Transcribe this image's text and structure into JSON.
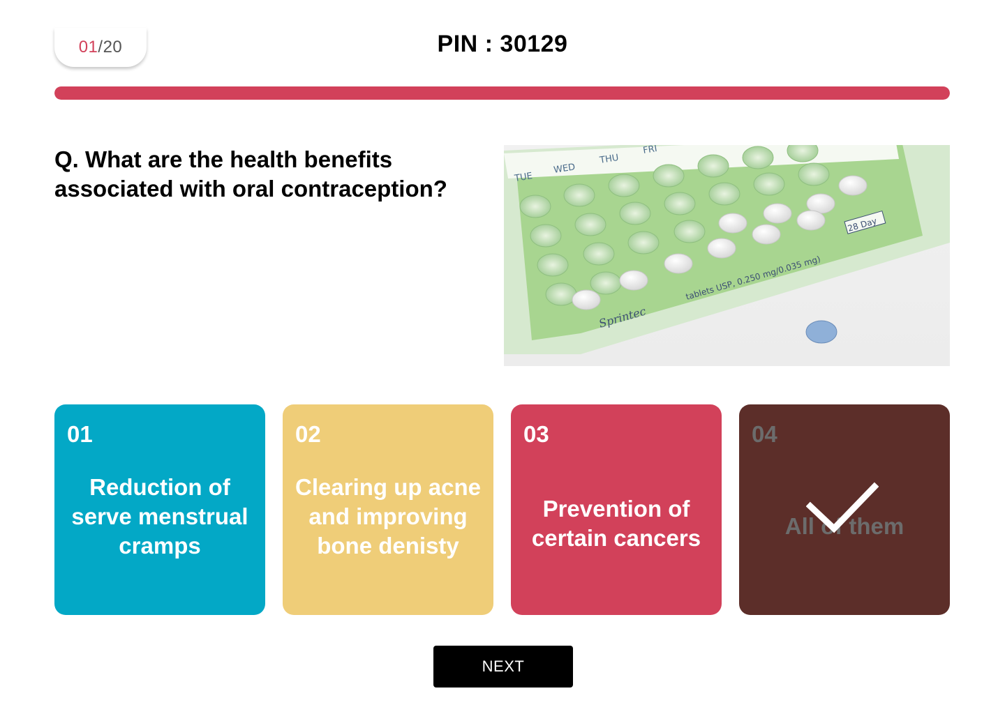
{
  "header": {
    "counter_current": "01",
    "counter_separator": "/",
    "counter_total": "20",
    "pin_label": "PIN : 30129"
  },
  "progress": {
    "fraction": 1.0,
    "color": "#d2415a"
  },
  "question": {
    "text": "Q. What are the health benefits associated with oral contraception?"
  },
  "image": {
    "subject": "birth control pill blister pack",
    "day_labels": [
      "TUE",
      "WED",
      "THU",
      "FRI"
    ],
    "label_28day": "28 Day",
    "brand": "Sprintec",
    "print_text": "tablets USP, 0.250 mg/0.035 mg)"
  },
  "options": [
    {
      "number": "01",
      "text": "Reduction of serve menstrual cramps",
      "color": "#03a8c6",
      "selected": false
    },
    {
      "number": "02",
      "text": "Clearing up acne and improving bone denisty",
      "color": "#efcd78",
      "selected": false
    },
    {
      "number": "03",
      "text": "Prevention of certain cancers",
      "color": "#d2415a",
      "selected": false
    },
    {
      "number": "04",
      "text": "All of them",
      "color": "#5c2e29",
      "selected": true,
      "icon": "checkmark-icon"
    }
  ],
  "footer": {
    "next_label": "NEXT"
  }
}
